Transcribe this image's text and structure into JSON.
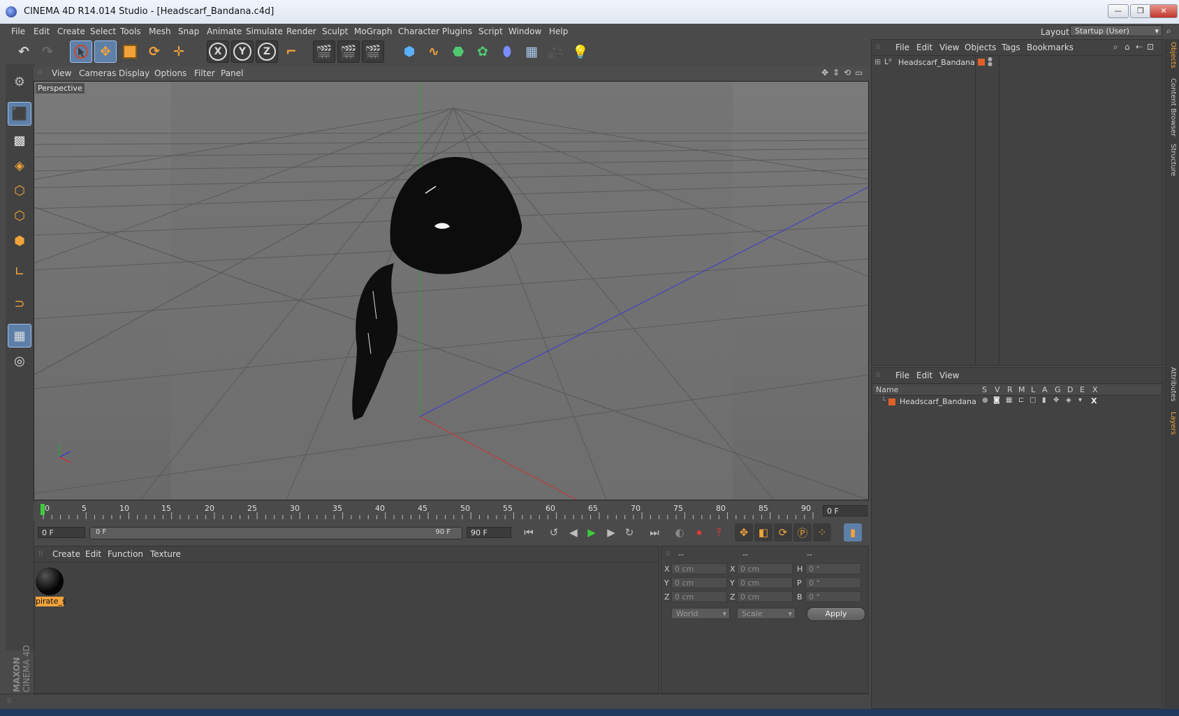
{
  "window": {
    "title": "CINEMA 4D R14.014 Studio - [Headscarf_Bandana.c4d]",
    "btn_min": "—",
    "btn_max": "❐",
    "btn_close": "✕"
  },
  "menubar": {
    "items": [
      "File",
      "Edit",
      "Create",
      "Select",
      "Tools",
      "Mesh",
      "Snap",
      "Animate",
      "Simulate",
      "Render",
      "Sculpt",
      "MoGraph",
      "Character",
      "Plugins",
      "Script",
      "Window",
      "Help"
    ],
    "layout_label": "Layout:",
    "layout_value": "Startup (User)"
  },
  "viewport": {
    "menu": [
      "View",
      "Cameras",
      "Display",
      "Options",
      "Filter",
      "Panel"
    ],
    "camera_label": "Perspective"
  },
  "timeline": {
    "ticks": [
      "0",
      "5",
      "10",
      "15",
      "20",
      "25",
      "30",
      "35",
      "40",
      "45",
      "50",
      "55",
      "60",
      "65",
      "70",
      "75",
      "80",
      "85",
      "90"
    ],
    "current_frame": "0 F",
    "start_field": "0 F",
    "range_start": "0 F",
    "range_end": "90 F",
    "end_field": "90 F"
  },
  "material_manager": {
    "menu": [
      "Create",
      "Edit",
      "Function",
      "Texture"
    ],
    "material_name": "pirate_s"
  },
  "coordinates": {
    "header": [
      "--",
      "--",
      "--"
    ],
    "rows": [
      {
        "axis1": "X",
        "val1": "0 cm",
        "axis2": "X",
        "val2": "0 cm",
        "axis3": "H",
        "val3": "0 °"
      },
      {
        "axis1": "Y",
        "val1": "0 cm",
        "axis2": "Y",
        "val2": "0 cm",
        "axis3": "P",
        "val3": "0 °"
      },
      {
        "axis1": "Z",
        "val1": "0 cm",
        "axis2": "Z",
        "val2": "0 cm",
        "axis3": "B",
        "val3": "0 °"
      }
    ],
    "mode1": "World",
    "mode2": "Scale",
    "apply": "Apply"
  },
  "objects_panel": {
    "menu": [
      "File",
      "Edit",
      "View",
      "Objects",
      "Tags",
      "Bookmarks"
    ],
    "object_name": "Headscarf_Bandana"
  },
  "layers_panel": {
    "menu": [
      "File",
      "Edit",
      "View"
    ],
    "columns": [
      "Name",
      "S",
      "V",
      "R",
      "M",
      "L",
      "A",
      "G",
      "D",
      "E",
      "X"
    ],
    "layer_name": "Headscarf_Bandana"
  },
  "side_tabs": [
    "Objects",
    "Content Browser",
    "Structure",
    "Attributes",
    "Layers"
  ],
  "colors": {
    "accent_orange": "#f1a33b",
    "selection_blue": "#5d7fa8",
    "layer_color": "#e0602a"
  }
}
